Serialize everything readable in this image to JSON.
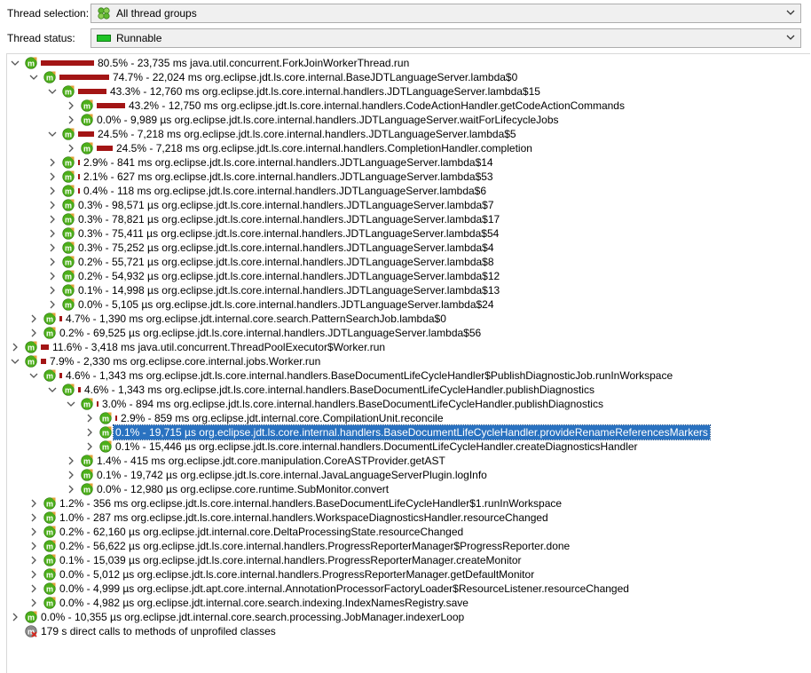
{
  "filters": {
    "thread_selection": {
      "label": "Thread selection:",
      "value": "All thread groups",
      "icon": "thread-groups-icon"
    },
    "thread_status": {
      "label": "Thread status:",
      "value": "Runnable",
      "icon": "runnable-status-icon",
      "color": "#1fc326"
    }
  },
  "colors": {
    "bar": "#a31515",
    "method_icon": "#4caf1a",
    "selection": "#2a72c0"
  },
  "tree": [
    {
      "level": 0,
      "expanded": true,
      "bar": 1.0,
      "text": "80.5% - 23,735 ms java.util.concurrent.ForkJoinWorkerThread.run"
    },
    {
      "level": 1,
      "expanded": true,
      "bar": 0.928,
      "text": "74.7% - 22,024 ms org.eclipse.jdt.ls.core.internal.BaseJDTLanguageServer.lambda$0"
    },
    {
      "level": 2,
      "expanded": true,
      "bar": 0.538,
      "text": "43.3% - 12,760 ms org.eclipse.jdt.ls.core.internal.handlers.JDTLanguageServer.lambda$15"
    },
    {
      "level": 3,
      "expanded": false,
      "bar": 0.537,
      "text": "43.2% - 12,750 ms org.eclipse.jdt.ls.core.internal.handlers.CodeActionHandler.getCodeActionCommands"
    },
    {
      "level": 3,
      "expanded": false,
      "bar": 0,
      "text": "0.0% - 9,989 µs org.eclipse.jdt.ls.core.internal.handlers.JDTLanguageServer.waitForLifecycleJobs"
    },
    {
      "level": 2,
      "expanded": true,
      "bar": 0.304,
      "text": "24.5% - 7,218 ms org.eclipse.jdt.ls.core.internal.handlers.JDTLanguageServer.lambda$5"
    },
    {
      "level": 3,
      "expanded": false,
      "bar": 0.304,
      "text": "24.5% - 7,218 ms org.eclipse.jdt.ls.core.internal.handlers.CompletionHandler.completion"
    },
    {
      "level": 2,
      "expanded": false,
      "bar": 0.036,
      "text": "2.9% - 841 ms org.eclipse.jdt.ls.core.internal.handlers.JDTLanguageServer.lambda$14"
    },
    {
      "level": 2,
      "expanded": false,
      "bar": 0.026,
      "text": "2.1% - 627 ms org.eclipse.jdt.ls.core.internal.handlers.JDTLanguageServer.lambda$53"
    },
    {
      "level": 2,
      "expanded": false,
      "bar": 0.005,
      "text": "0.4% - 118 ms org.eclipse.jdt.ls.core.internal.handlers.JDTLanguageServer.lambda$6"
    },
    {
      "level": 2,
      "expanded": false,
      "bar": 0,
      "text": "0.3% - 98,571 µs org.eclipse.jdt.ls.core.internal.handlers.JDTLanguageServer.lambda$7"
    },
    {
      "level": 2,
      "expanded": false,
      "bar": 0,
      "text": "0.3% - 78,821 µs org.eclipse.jdt.ls.core.internal.handlers.JDTLanguageServer.lambda$17"
    },
    {
      "level": 2,
      "expanded": false,
      "bar": 0,
      "text": "0.3% - 75,411 µs org.eclipse.jdt.ls.core.internal.handlers.JDTLanguageServer.lambda$54"
    },
    {
      "level": 2,
      "expanded": false,
      "bar": 0,
      "text": "0.3% - 75,252 µs org.eclipse.jdt.ls.core.internal.handlers.JDTLanguageServer.lambda$4"
    },
    {
      "level": 2,
      "expanded": false,
      "bar": 0,
      "text": "0.2% - 55,721 µs org.eclipse.jdt.ls.core.internal.handlers.JDTLanguageServer.lambda$8"
    },
    {
      "level": 2,
      "expanded": false,
      "bar": 0,
      "text": "0.2% - 54,932 µs org.eclipse.jdt.ls.core.internal.handlers.JDTLanguageServer.lambda$12"
    },
    {
      "level": 2,
      "expanded": false,
      "bar": 0,
      "text": "0.1% - 14,998 µs org.eclipse.jdt.ls.core.internal.handlers.JDTLanguageServer.lambda$13"
    },
    {
      "level": 2,
      "expanded": false,
      "bar": 0,
      "text": "0.0% - 5,105 µs org.eclipse.jdt.ls.core.internal.handlers.JDTLanguageServer.lambda$24"
    },
    {
      "level": 1,
      "expanded": false,
      "bar": 0.058,
      "text": "4.7% - 1,390 ms org.eclipse.jdt.internal.core.search.PatternSearchJob.lambda$0"
    },
    {
      "level": 1,
      "expanded": false,
      "bar": 0,
      "text": "0.2% - 69,525 µs org.eclipse.jdt.ls.core.internal.handlers.JDTLanguageServer.lambda$56"
    },
    {
      "level": 0,
      "expanded": false,
      "bar": 0.144,
      "text": "11.6% - 3,418 ms java.util.concurrent.ThreadPoolExecutor$Worker.run"
    },
    {
      "level": 0,
      "expanded": true,
      "bar": 0.098,
      "text": "7.9% - 2,330 ms org.eclipse.core.internal.jobs.Worker.run"
    },
    {
      "level": 1,
      "expanded": true,
      "bar": 0.057,
      "text": "4.6% - 1,343 ms org.eclipse.jdt.ls.core.internal.handlers.BaseDocumentLifeCycleHandler$PublishDiagnosticJob.runInWorkspace"
    },
    {
      "level": 2,
      "expanded": true,
      "bar": 0.057,
      "text": "4.6% - 1,343 ms org.eclipse.jdt.ls.core.internal.handlers.BaseDocumentLifeCycleHandler.publishDiagnostics"
    },
    {
      "level": 3,
      "expanded": true,
      "bar": 0.037,
      "text": "3.0% - 894 ms org.eclipse.jdt.ls.core.internal.handlers.BaseDocumentLifeCycleHandler.publishDiagnostics"
    },
    {
      "level": 4,
      "expanded": false,
      "bar": 0.036,
      "text": "2.9% - 859 ms org.eclipse.jdt.internal.core.CompilationUnit.reconcile"
    },
    {
      "level": 4,
      "expanded": false,
      "bar": 0,
      "selected": true,
      "text": "0.1% - 19,715 µs org.eclipse.jdt.ls.core.internal.handlers.BaseDocumentLifeCycleHandler.provideRenameReferencesMarkers"
    },
    {
      "level": 4,
      "expanded": false,
      "bar": 0,
      "text": "0.1% - 15,446 µs org.eclipse.jdt.ls.core.internal.handlers.DocumentLifeCycleHandler.createDiagnosticsHandler"
    },
    {
      "level": 3,
      "expanded": false,
      "bar": 0,
      "text": "1.4% - 415 ms org.eclipse.jdt.core.manipulation.CoreASTProvider.getAST"
    },
    {
      "level": 3,
      "expanded": false,
      "bar": 0,
      "text": "0.1% - 19,742 µs org.eclipse.jdt.ls.core.internal.JavaLanguageServerPlugin.logInfo"
    },
    {
      "level": 3,
      "expanded": false,
      "bar": 0,
      "text": "0.0% - 12,980 µs org.eclipse.core.runtime.SubMonitor.convert"
    },
    {
      "level": 1,
      "expanded": false,
      "bar": 0,
      "text": "1.2% - 356 ms org.eclipse.jdt.ls.core.internal.handlers.BaseDocumentLifeCycleHandler$1.runInWorkspace"
    },
    {
      "level": 1,
      "expanded": false,
      "bar": 0,
      "text": "1.0% - 287 ms org.eclipse.jdt.ls.core.internal.handlers.WorkspaceDiagnosticsHandler.resourceChanged"
    },
    {
      "level": 1,
      "expanded": false,
      "bar": 0,
      "text": "0.2% - 62,160 µs org.eclipse.jdt.internal.core.DeltaProcessingState.resourceChanged"
    },
    {
      "level": 1,
      "expanded": false,
      "bar": 0,
      "text": "0.2% - 56,622 µs org.eclipse.jdt.ls.core.internal.handlers.ProgressReporterManager$ProgressReporter.done"
    },
    {
      "level": 1,
      "expanded": false,
      "bar": 0,
      "text": "0.1% - 15,039 µs org.eclipse.jdt.ls.core.internal.handlers.ProgressReporterManager.createMonitor"
    },
    {
      "level": 1,
      "expanded": false,
      "bar": 0,
      "text": "0.0% - 5,012 µs org.eclipse.jdt.ls.core.internal.handlers.ProgressReporterManager.getDefaultMonitor"
    },
    {
      "level": 1,
      "expanded": false,
      "bar": 0,
      "text": "0.0% - 4,999 µs org.eclipse.jdt.apt.core.internal.AnnotationProcessorFactoryLoader$ResourceListener.resourceChanged"
    },
    {
      "level": 1,
      "expanded": false,
      "bar": 0,
      "text": "0.0% - 4,982 µs org.eclipse.jdt.internal.core.search.indexing.IndexNamesRegistry.save"
    },
    {
      "level": 0,
      "expanded": false,
      "bar": 0,
      "text": "0.0% - 10,355 µs org.eclipse.jdt.internal.core.search.processing.JobManager.indexerLoop"
    },
    {
      "level": 0,
      "leaf": true,
      "unprofiled": true,
      "bar": 0,
      "text": "179 s direct calls to methods of unprofiled classes"
    }
  ]
}
